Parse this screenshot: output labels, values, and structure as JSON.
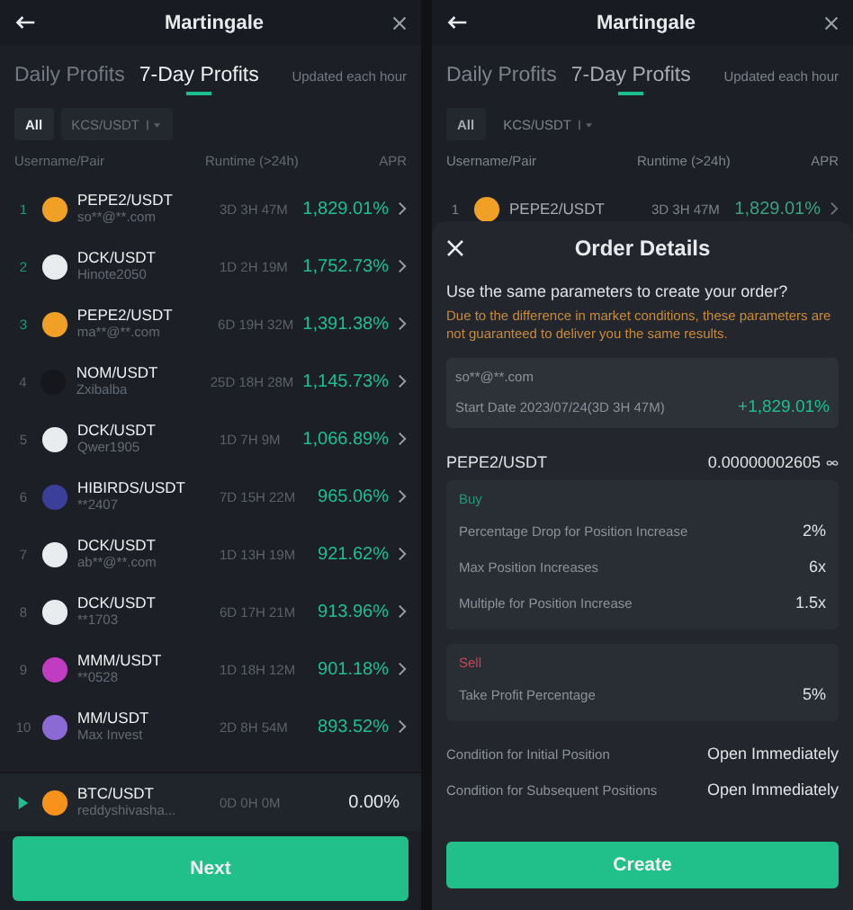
{
  "list_screen": {
    "title": "Martingale",
    "tabs": [
      {
        "label": "Daily Profits",
        "selected": false
      },
      {
        "label": "7-Day Profits",
        "selected": true
      }
    ],
    "update_note": "Updated each hour",
    "filters": [
      {
        "label": "All",
        "selected": true
      },
      {
        "label": "KCS/USDT",
        "selected": false
      }
    ],
    "columns": [
      "Username/Pair",
      "Runtime (>24h)",
      "APR"
    ],
    "rows": [
      {
        "rank": "1",
        "top": true,
        "color": "#f0a024",
        "pair": "PEPE2/USDT",
        "user": "so**@**.com",
        "runtime": "3D 3H 47M",
        "apr": "1,829.01%"
      },
      {
        "rank": "2",
        "top": true,
        "color": "#e9ecef",
        "pair": "DCK/USDT",
        "user": "Hinote2050",
        "runtime": "1D 2H 19M",
        "apr": "1,752.73%"
      },
      {
        "rank": "3",
        "top": true,
        "color": "#f0a024",
        "pair": "PEPE2/USDT",
        "user": "ma**@**.com",
        "runtime": "6D 19H 32M",
        "apr": "1,391.38%"
      },
      {
        "rank": "4",
        "top": false,
        "color": "#15171c",
        "pair": "NOM/USDT",
        "user": "Zxibalba",
        "runtime": "25D 18H 28M",
        "apr": "1,145.73%"
      },
      {
        "rank": "5",
        "top": false,
        "color": "#e9ecef",
        "pair": "DCK/USDT",
        "user": "Qwer1905",
        "runtime": "1D 7H 9M",
        "apr": "1,066.89%"
      },
      {
        "rank": "6",
        "top": false,
        "color": "#3b3f9a",
        "pair": "HIBIRDS/USDT",
        "user": "**2407",
        "runtime": "7D 15H 22M",
        "apr": "965.06%"
      },
      {
        "rank": "7",
        "top": false,
        "color": "#e9ecef",
        "pair": "DCK/USDT",
        "user": "ab**@**.com",
        "runtime": "1D 13H 19M",
        "apr": "921.62%"
      },
      {
        "rank": "8",
        "top": false,
        "color": "#e9ecef",
        "pair": "DCK/USDT",
        "user": "**1703",
        "runtime": "6D 17H 21M",
        "apr": "913.96%"
      },
      {
        "rank": "9",
        "top": false,
        "color": "#c03cc0",
        "pair": "MMM/USDT",
        "user": "**0528",
        "runtime": "1D 18H 12M",
        "apr": "901.18%"
      },
      {
        "rank": "10",
        "top": false,
        "color": "#8c6ad6",
        "pair": "MM/USDT",
        "user": "Max Invest",
        "runtime": "2D 8H 54M",
        "apr": "893.52%"
      }
    ],
    "own_row": {
      "color": "#f7931a",
      "pair": "BTC/USDT",
      "user": "reddyshivasha...",
      "runtime": "0D 0H 0M",
      "apr": "0.00%"
    },
    "button": "Next"
  },
  "detail_screen": {
    "title": "Martingale",
    "tabs": [
      {
        "label": "Daily Profits",
        "selected": false
      },
      {
        "label": "7-Day Profits",
        "selected": true
      }
    ],
    "update_note": "Updated each hour",
    "filters": [
      {
        "label": "All",
        "selected": true
      },
      {
        "label": "KCS/USDT",
        "selected": false
      }
    ],
    "columns": [
      "Username/Pair",
      "Runtime (>24h)",
      "APR"
    ],
    "rows": [
      {
        "rank": "1",
        "top": false,
        "color": "#f0a024",
        "pair": "PEPE2/USDT",
        "runtime": "3D 3H 47M",
        "apr": "1,829.01%"
      }
    ],
    "sheet": {
      "title": "Order Details",
      "question": "Use the same parameters to create your order?",
      "warning": "Due to the difference in market conditions, these parameters are not guaranteed to deliver you the same results.",
      "source": {
        "user": "so**@**.com",
        "start_date": "Start Date 2023/07/24(3D 3H 47M)",
        "apr": "+1,829.01%"
      },
      "pair": "PEPE2/USDT",
      "price": "0.00000002605",
      "buy": {
        "label": "Buy",
        "params": [
          {
            "label": "Percentage Drop for Position Increase",
            "value": "2%"
          },
          {
            "label": "Max Position Increases",
            "value": "6x"
          },
          {
            "label": "Multiple for Position Increase",
            "value": "1.5x"
          }
        ]
      },
      "sell": {
        "label": "Sell",
        "params": [
          {
            "label": "Take Profit Percentage",
            "value": "5%"
          }
        ]
      },
      "conditions": [
        {
          "label": "Condition for Initial Position",
          "value": "Open Immediately"
        },
        {
          "label": "Condition for Subsequent Positions",
          "value": "Open Immediately"
        }
      ],
      "button": "Create"
    }
  }
}
